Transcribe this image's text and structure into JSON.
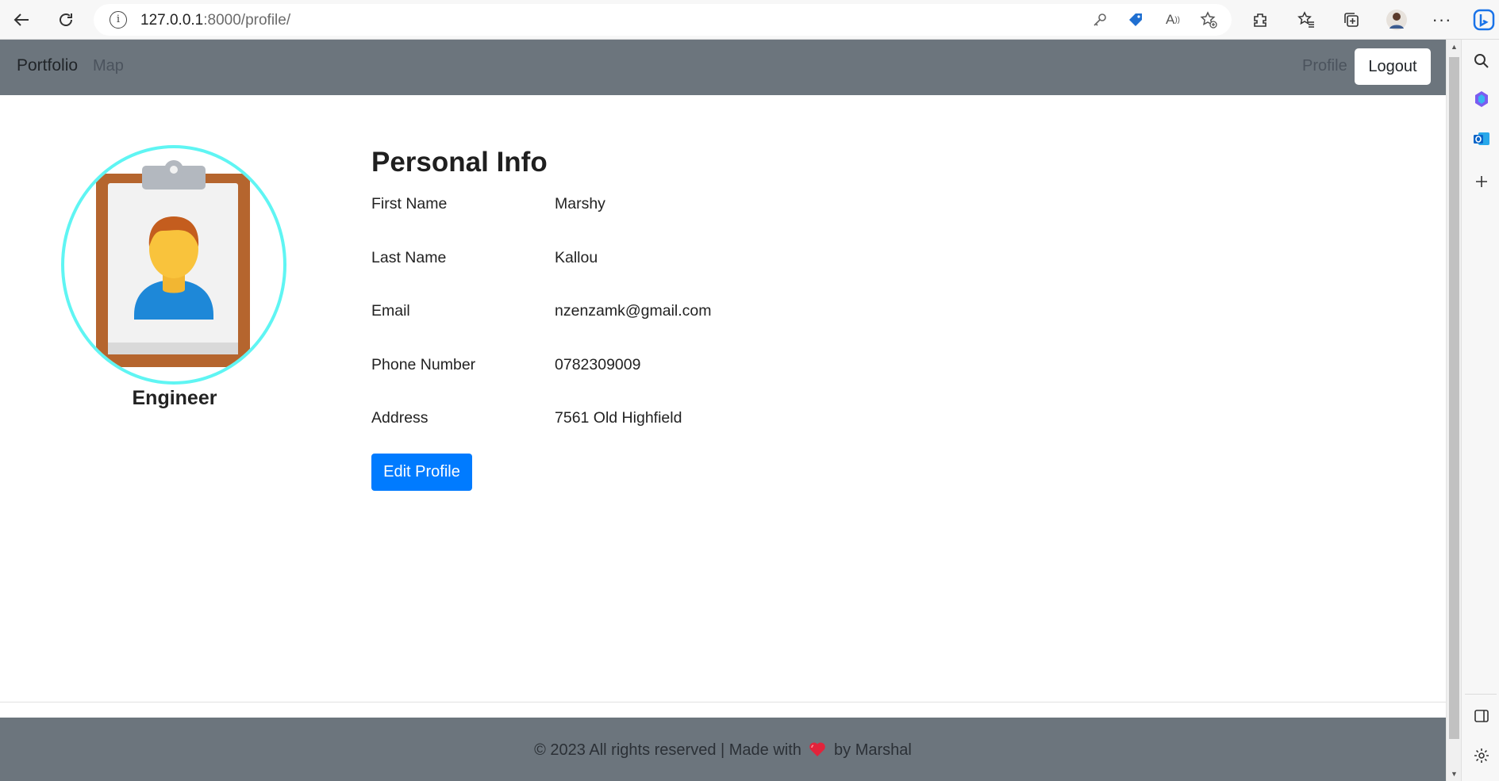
{
  "browser": {
    "url_host": "127.0.0.1",
    "url_rest": ":8000/profile/"
  },
  "navbar": {
    "brand": "Portfolio",
    "links": [
      "Map",
      "Profile"
    ],
    "logout_label": "Logout"
  },
  "profile": {
    "role": "Engineer",
    "section_title": "Personal Info",
    "fields": [
      {
        "label": "First Name",
        "value": "Marshy"
      },
      {
        "label": "Last Name",
        "value": "Kallou"
      },
      {
        "label": "Email",
        "value": "nzenzamk@gmail.com"
      },
      {
        "label": "Phone Number",
        "value": "0782309009"
      },
      {
        "label": "Address",
        "value": "7561 Old Highfield"
      }
    ],
    "edit_button": "Edit Profile"
  },
  "footer": {
    "before_heart": "© 2023 All rights reserved | Made with",
    "after_heart": "by Marshal"
  },
  "colors": {
    "navbar_bg": "#6c757d",
    "primary_button": "#007bff",
    "avatar_ring": "#5ff5f3"
  },
  "icons": [
    "back-arrow-icon",
    "refresh-icon",
    "info-icon",
    "key-icon",
    "tag-icon",
    "read-aloud-icon",
    "add-favorite-icon",
    "extensions-icon",
    "favorites-icon",
    "collections-icon",
    "profile-avatar-icon",
    "more-icon",
    "bing-icon",
    "search-icon",
    "copilot-icon",
    "outlook-icon",
    "plus-icon",
    "sidebar-toggle-icon",
    "settings-icon",
    "heart-icon"
  ]
}
